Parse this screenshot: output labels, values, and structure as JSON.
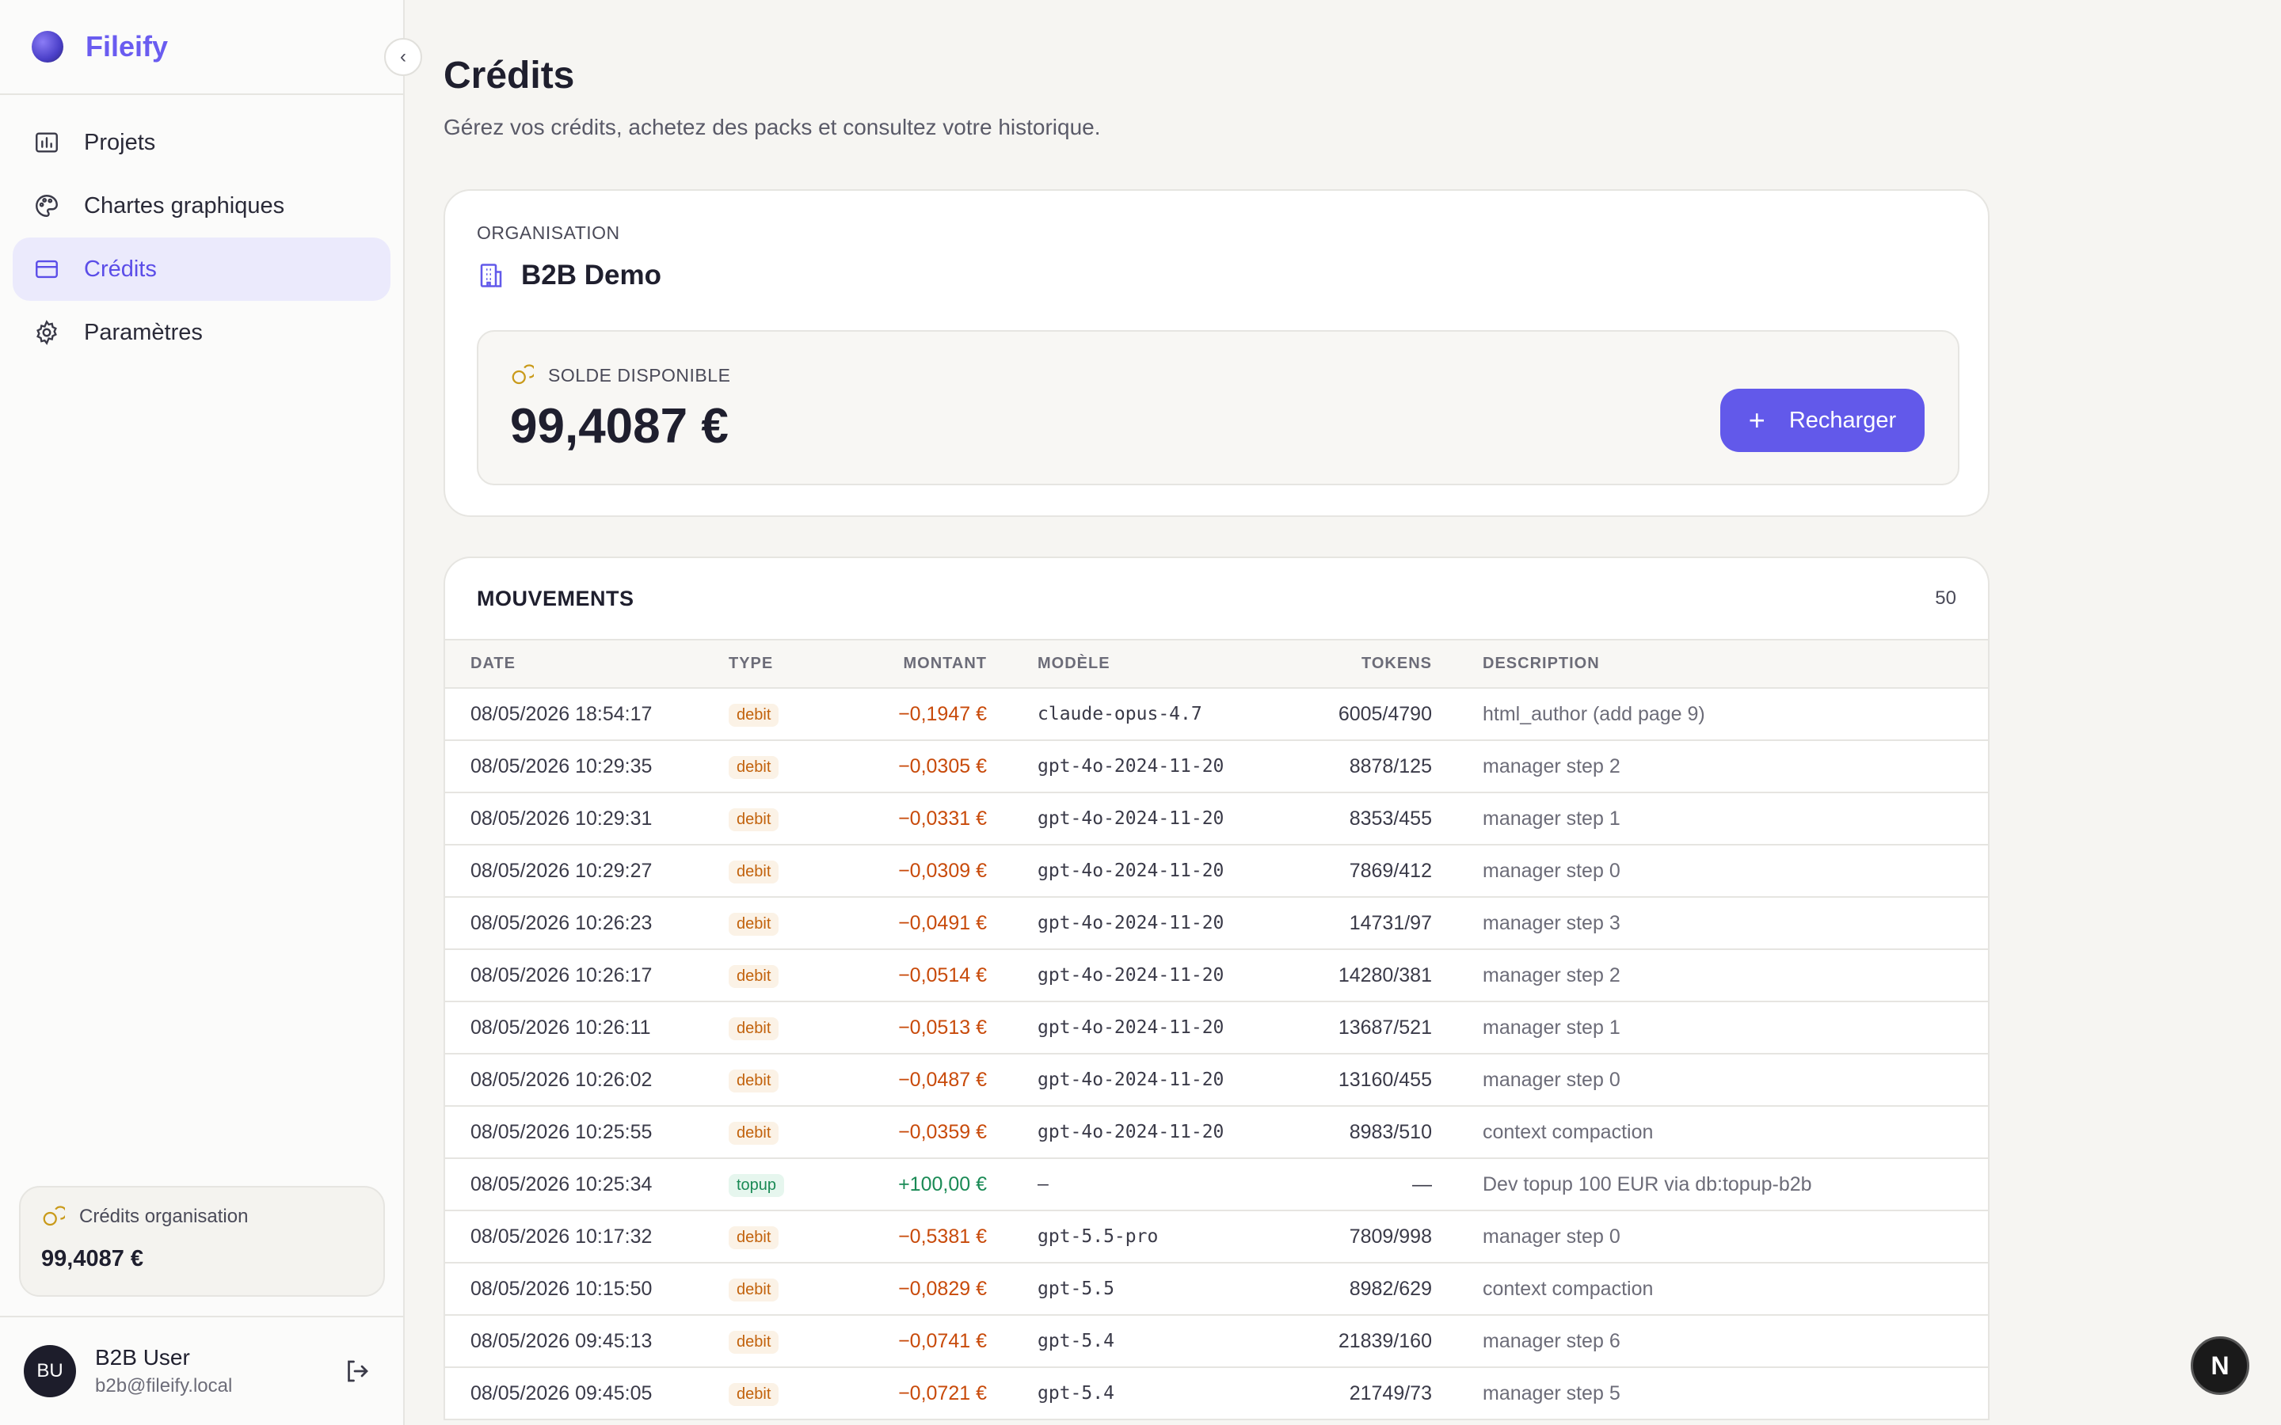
{
  "app": {
    "name": "Fileify"
  },
  "sidebar": {
    "items": [
      {
        "label": "Projets",
        "icon": "chart-bar-icon"
      },
      {
        "label": "Chartes graphiques",
        "icon": "palette-icon"
      },
      {
        "label": "Crédits",
        "icon": "credit-card-icon",
        "active": true
      },
      {
        "label": "Paramètres",
        "icon": "gear-icon"
      }
    ],
    "credits_card": {
      "label": "Crédits organisation",
      "value": "99,4087 €"
    },
    "user": {
      "initials": "BU",
      "name": "B2B User",
      "email": "b2b@fileify.local"
    }
  },
  "page": {
    "title": "Crédits",
    "subtitle": "Gérez vos crédits, achetez des packs et consultez votre historique."
  },
  "organisation": {
    "label": "ORGANISATION",
    "name": "B2B Demo",
    "balance_label": "SOLDE DISPONIBLE",
    "balance_value": "99,4087 €",
    "recharge_label": "Recharger"
  },
  "movements": {
    "title": "MOUVEMENTS",
    "count": "50",
    "columns": [
      "DATE",
      "TYPE",
      "MONTANT",
      "MODÈLE",
      "TOKENS",
      "DESCRIPTION"
    ],
    "rows": [
      {
        "date": "08/05/2026 18:54:17",
        "type": "debit",
        "amount": "−0,1947 €",
        "model": "claude-opus-4.7",
        "tokens": "6005/4790",
        "desc": "html_author (add page 9)"
      },
      {
        "date": "08/05/2026 10:29:35",
        "type": "debit",
        "amount": "−0,0305 €",
        "model": "gpt-4o-2024-11-20",
        "tokens": "8878/125",
        "desc": "manager step 2"
      },
      {
        "date": "08/05/2026 10:29:31",
        "type": "debit",
        "amount": "−0,0331 €",
        "model": "gpt-4o-2024-11-20",
        "tokens": "8353/455",
        "desc": "manager step 1"
      },
      {
        "date": "08/05/2026 10:29:27",
        "type": "debit",
        "amount": "−0,0309 €",
        "model": "gpt-4o-2024-11-20",
        "tokens": "7869/412",
        "desc": "manager step 0"
      },
      {
        "date": "08/05/2026 10:26:23",
        "type": "debit",
        "amount": "−0,0491 €",
        "model": "gpt-4o-2024-11-20",
        "tokens": "14731/97",
        "desc": "manager step 3"
      },
      {
        "date": "08/05/2026 10:26:17",
        "type": "debit",
        "amount": "−0,0514 €",
        "model": "gpt-4o-2024-11-20",
        "tokens": "14280/381",
        "desc": "manager step 2"
      },
      {
        "date": "08/05/2026 10:26:11",
        "type": "debit",
        "amount": "−0,0513 €",
        "model": "gpt-4o-2024-11-20",
        "tokens": "13687/521",
        "desc": "manager step 1"
      },
      {
        "date": "08/05/2026 10:26:02",
        "type": "debit",
        "amount": "−0,0487 €",
        "model": "gpt-4o-2024-11-20",
        "tokens": "13160/455",
        "desc": "manager step 0"
      },
      {
        "date": "08/05/2026 10:25:55",
        "type": "debit",
        "amount": "−0,0359 €",
        "model": "gpt-4o-2024-11-20",
        "tokens": "8983/510",
        "desc": "context compaction"
      },
      {
        "date": "08/05/2026 10:25:34",
        "type": "topup",
        "amount": "+100,00 €",
        "model": "—",
        "tokens": "—",
        "desc": "Dev topup 100 EUR via db:topup-b2b"
      },
      {
        "date": "08/05/2026 10:17:32",
        "type": "debit",
        "amount": "−0,5381 €",
        "model": "gpt-5.5-pro",
        "tokens": "7809/998",
        "desc": "manager step 0"
      },
      {
        "date": "08/05/2026 10:15:50",
        "type": "debit",
        "amount": "−0,0829 €",
        "model": "gpt-5.5",
        "tokens": "8982/629",
        "desc": "context compaction"
      },
      {
        "date": "08/05/2026 09:45:13",
        "type": "debit",
        "amount": "−0,0741 €",
        "model": "gpt-5.4",
        "tokens": "21839/160",
        "desc": "manager step 6"
      },
      {
        "date": "08/05/2026 09:45:05",
        "type": "debit",
        "amount": "−0,0721 €",
        "model": "gpt-5.4",
        "tokens": "21749/73",
        "desc": "manager step 5"
      }
    ]
  },
  "floating": {
    "label": "N"
  },
  "colors": {
    "accent": "#6259ea",
    "debit": "#c84a0a",
    "topup": "#1a8a55"
  }
}
